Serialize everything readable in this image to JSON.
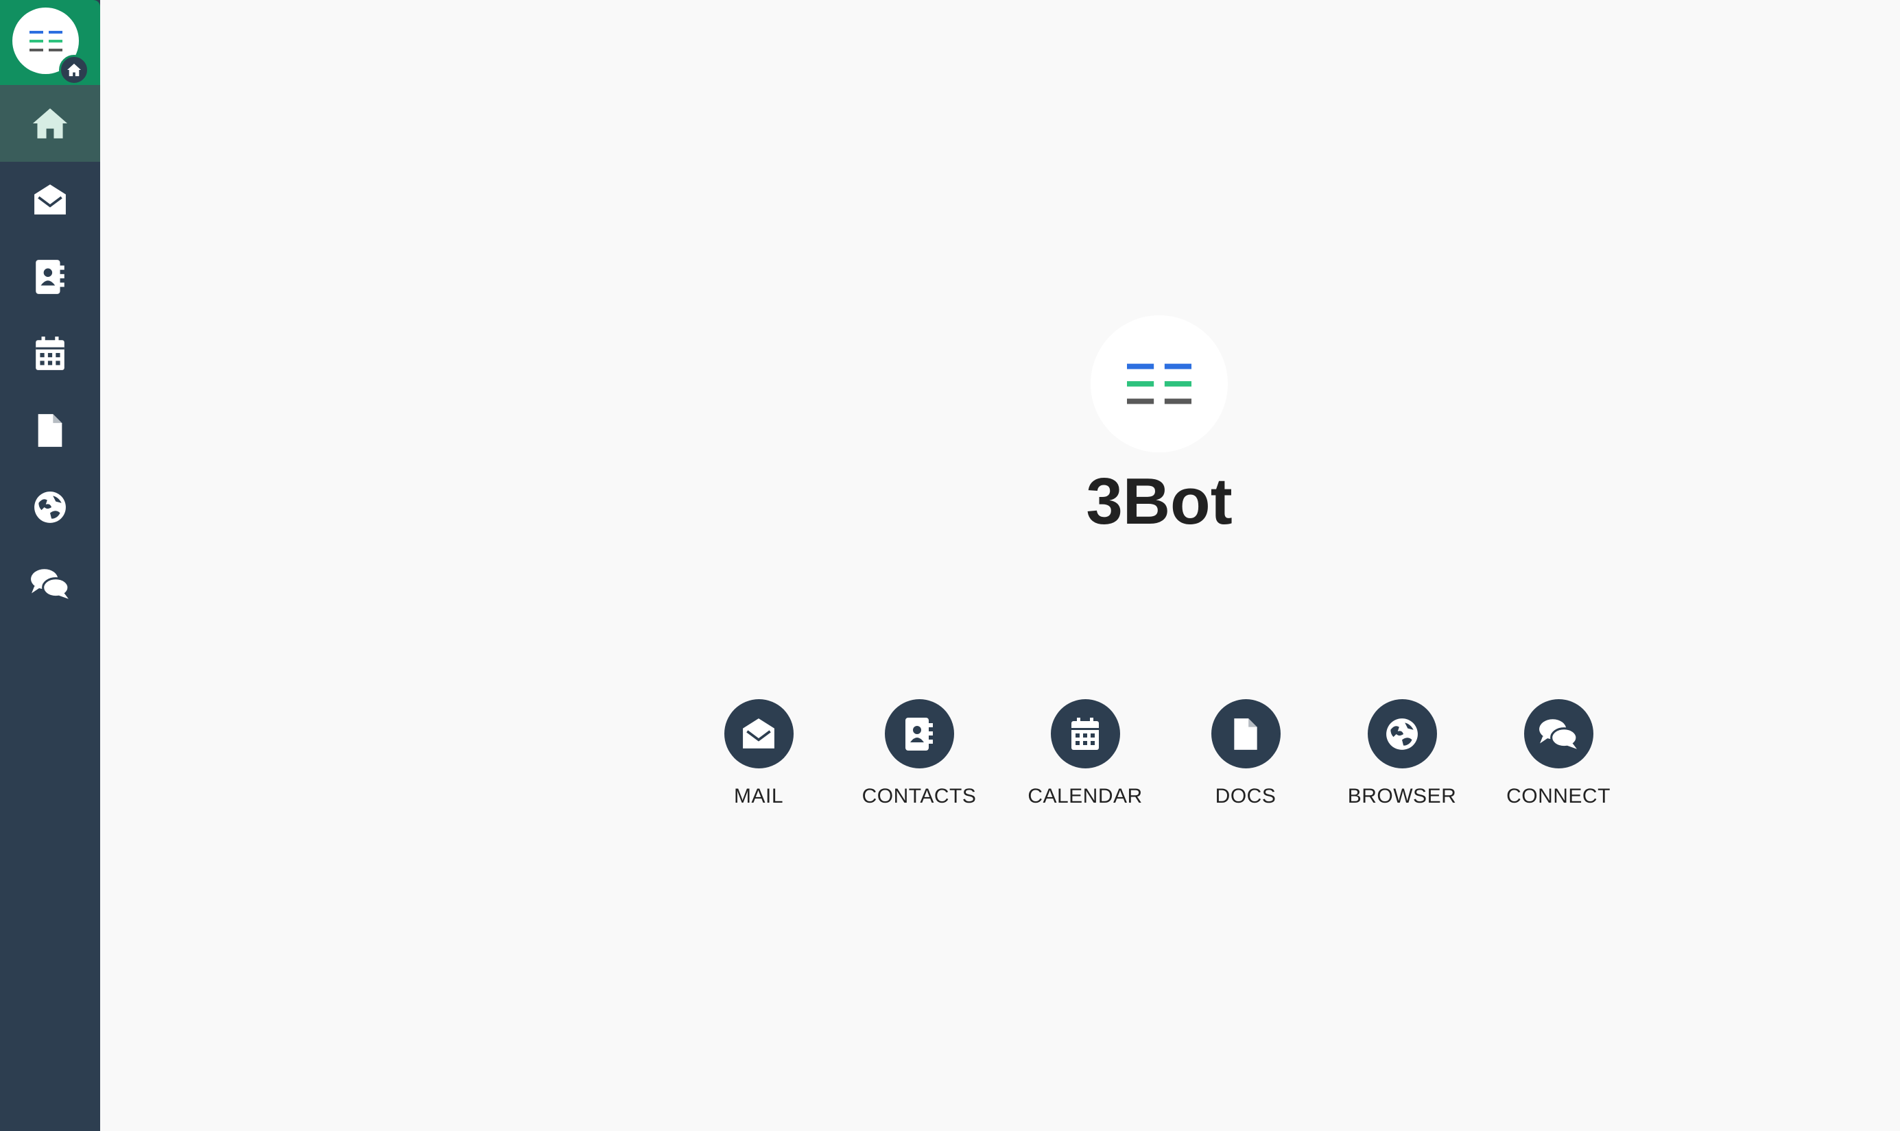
{
  "sidebar": {
    "items": [
      {
        "icon": "home-icon",
        "active": true
      },
      {
        "icon": "mail-icon",
        "active": false
      },
      {
        "icon": "contacts-icon",
        "active": false
      },
      {
        "icon": "calendar-icon",
        "active": false
      },
      {
        "icon": "docs-icon",
        "active": false
      },
      {
        "icon": "browser-icon",
        "active": false
      },
      {
        "icon": "connect-icon",
        "active": false
      }
    ]
  },
  "main": {
    "title": "3Bot",
    "apps": [
      {
        "label": "MAIL",
        "icon": "mail-icon"
      },
      {
        "label": "CONTACTS",
        "icon": "contacts-icon"
      },
      {
        "label": "CALENDAR",
        "icon": "calendar-icon"
      },
      {
        "label": "DOCS",
        "icon": "docs-icon"
      },
      {
        "label": "BROWSER",
        "icon": "browser-icon"
      },
      {
        "label": "CONNECT",
        "icon": "connect-icon"
      }
    ]
  },
  "colors": {
    "sidebar_bg": "#2d3e50",
    "brand_green": "#119060",
    "active_item": "#3a5d5b",
    "logo_blue": "#2d6fe0",
    "logo_green": "#2ec27e",
    "logo_gray": "#5a5a5a",
    "page_bg": "#f9f9f9"
  }
}
